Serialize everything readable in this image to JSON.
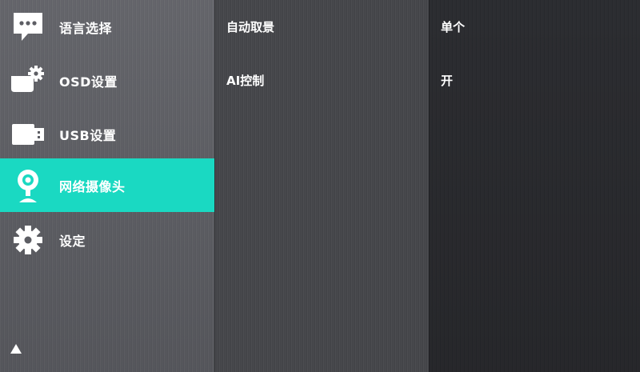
{
  "menu": {
    "items": [
      {
        "label": "语言选择",
        "icon": "speech-bubble-icon"
      },
      {
        "label": "OSD设置",
        "icon": "display-gear-icon"
      },
      {
        "label": "USB设置",
        "icon": "usb-drive-icon"
      },
      {
        "label": "网络摄像头",
        "icon": "webcam-icon",
        "selected": true
      },
      {
        "label": "设定",
        "icon": "gear-icon"
      }
    ],
    "scroll_icon": "triangle-up-icon"
  },
  "options": {
    "items": [
      {
        "label": "自动取景"
      },
      {
        "label": "AI控制"
      }
    ]
  },
  "values": {
    "items": [
      {
        "label": "单个"
      },
      {
        "label": "开"
      }
    ]
  },
  "colors": {
    "accent": "#1ad9c2",
    "menu_bg": "#5d5e64",
    "options_bg": "#46474b",
    "values_bg": "#2a2b2f",
    "text": "#ffffff"
  }
}
